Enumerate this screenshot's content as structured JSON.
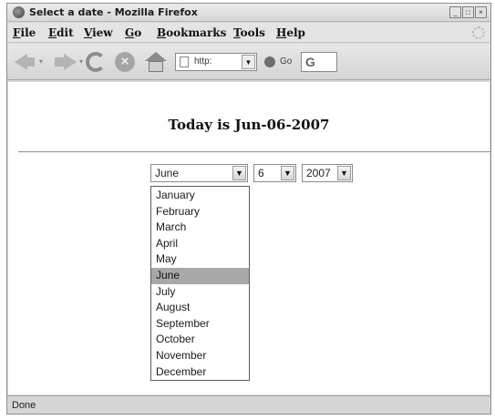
{
  "window": {
    "title": "Select a date - Mozilla Firefox"
  },
  "menubar": {
    "items": [
      "File",
      "Edit",
      "View",
      "Go",
      "Bookmarks",
      "Tools",
      "Help"
    ]
  },
  "toolbar": {
    "back_icon": "back-arrow-icon",
    "forward_icon": "forward-arrow-icon",
    "reload_icon": "reload-icon",
    "stop_icon": "stop-icon",
    "home_icon": "home-icon",
    "url_text": "http:",
    "go_label": "Go",
    "search_icon": "google-search-icon"
  },
  "page": {
    "heading": "Today is Jun-06-2007",
    "month_select": {
      "value": "June"
    },
    "day_select": {
      "value": "6"
    },
    "year_select": {
      "value": "2007"
    },
    "month_options": [
      "January",
      "February",
      "March",
      "April",
      "May",
      "June",
      "July",
      "August",
      "September",
      "October",
      "November",
      "December"
    ],
    "highlighted_option": "June"
  },
  "statusbar": {
    "text": "Done"
  },
  "colors": {
    "highlight": "#a8a8a8",
    "chrome": "#d8d8d8"
  }
}
